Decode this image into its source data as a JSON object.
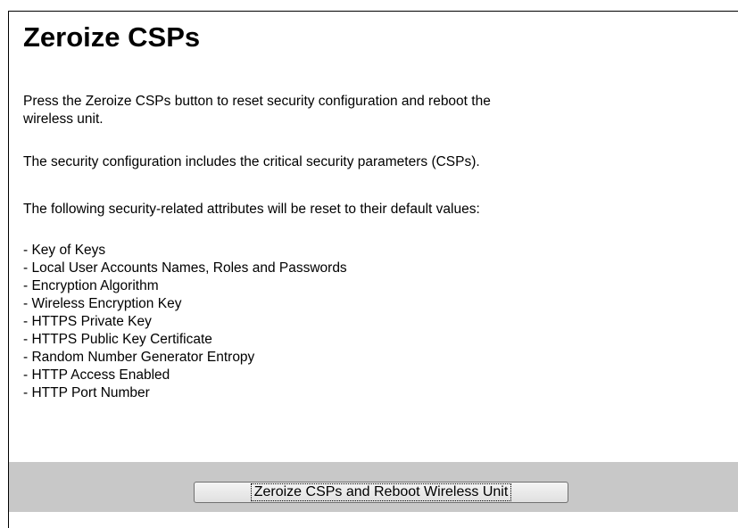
{
  "page": {
    "title": "Zeroize CSPs",
    "intro_line1": "Press the Zeroize CSPs button to reset security configuration and reboot the",
    "intro_line2": "wireless unit.",
    "definition": "The security configuration includes the critical security parameters (CSPs).",
    "list_heading": "The following security-related attributes will be reset to their default values:",
    "attributes": [
      "- Key of Keys",
      "- Local User Accounts Names, Roles and Passwords",
      "- Encryption Algorithm",
      "- Wireless Encryption Key",
      "- HTTPS Private Key",
      "- HTTPS Public Key Certificate",
      "- Random Number Generator Entropy",
      "- HTTP Access Enabled",
      "- HTTP Port Number"
    ]
  },
  "actions": {
    "zeroize_label": "Zeroize CSPs and Reboot Wireless Unit"
  },
  "colors": {
    "action_bar_background": "#c8c8c8",
    "text": "#000000",
    "background": "#ffffff"
  }
}
